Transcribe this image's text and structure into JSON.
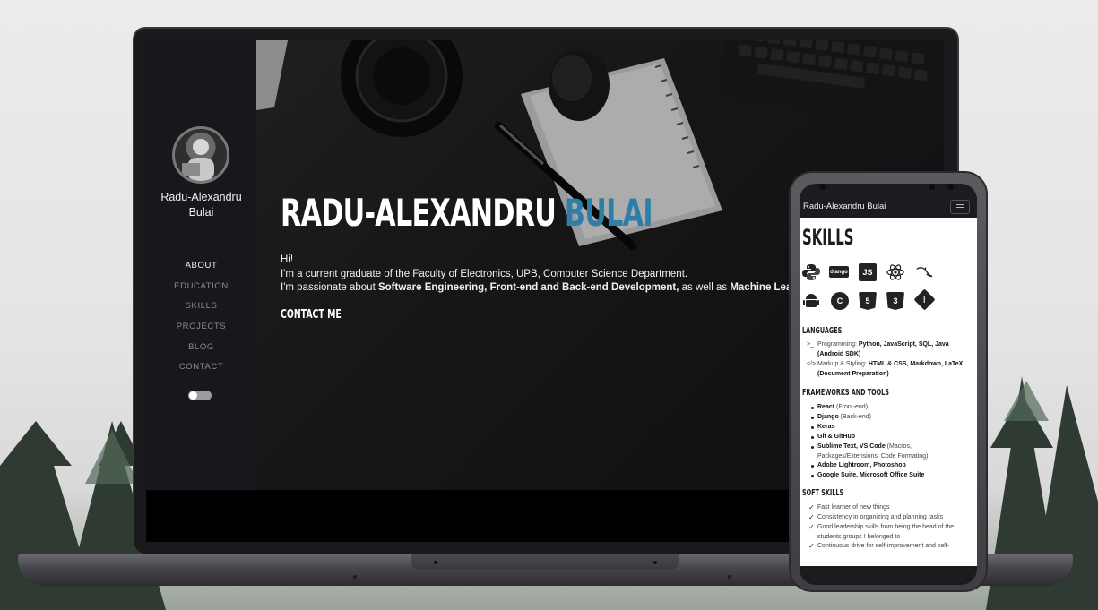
{
  "laptop": {
    "sidebar": {
      "name_line1": "Radu-Alexandru",
      "name_line2": "Bulai",
      "nav": [
        "ABOUT",
        "EDUCATION",
        "SKILLS",
        "PROJECTS",
        "BLOG",
        "CONTACT"
      ],
      "active": "ABOUT"
    },
    "hero": {
      "first_name": "RADU-ALEXANDRU",
      "last_name": "BULAI",
      "greeting": "Hi!",
      "line2": "I'm a current graduate of the Faculty of Electronics, UPB, Computer Science Department.",
      "line3_a": "I'm passionate about ",
      "line3_b": "Software Engineering, Front-end and Back-end Development,",
      "line3_c": " as well as ",
      "line3_d": "Machine Learning a",
      "contact": "CONTACT ME"
    }
  },
  "phone": {
    "header_title": "Radu-Alexandru Bulai",
    "skills_title": "SKILLS",
    "icons": [
      "python-icon",
      "django-icon",
      "js-icon",
      "react-icon",
      "mysql-icon",
      "android-icon",
      "c-icon",
      "html5-icon",
      "css3-icon",
      "git-icon"
    ],
    "icon_labels": {
      "django": "django",
      "js": "JS",
      "c": "C",
      "html": "5",
      "css": "3"
    },
    "languages": {
      "title": "LANGUAGES",
      "prog_label": "Programming: ",
      "prog_value": "Python, JavaScript, SQL, Java",
      "prog_value2": "(Android SDK)",
      "markup_label": "Markup & Styling: ",
      "markup_value": "HTML & CSS, Markdown, LaTeX",
      "markup_value2": "(Document Preparation)"
    },
    "frameworks": {
      "title": "FRAMEWORKS AND TOOLS",
      "items": [
        {
          "name": "React",
          "note": " (Front-end)"
        },
        {
          "name": "Django",
          "note": " (Back-end)"
        },
        {
          "name": "Keras",
          "note": ""
        },
        {
          "name": "Git & GitHub",
          "note": ""
        },
        {
          "name": "Sublime Text, VS Code",
          "note": " (Macros,"
        },
        {
          "name": "",
          "note": "Packages/Extensions, Code Formating)"
        },
        {
          "name": "Adobe Lightroom, Photoshop",
          "note": ""
        },
        {
          "name": "Google Suite, Microsoft Office Suite",
          "note": ""
        }
      ]
    },
    "soft_skills": {
      "title": "SOFT SKILLS",
      "items": [
        "Fast learner of new things",
        "Consistency in organizing and planning tasks",
        "Good leadership skills from being the head of the",
        "students groups I belonged to",
        "Continuous drive for self-improvement and self-"
      ]
    }
  },
  "colors": {
    "accent": "#2f7ea8",
    "sidebar_bg": "#17181c",
    "phone_header_bg": "#1b1c20"
  }
}
